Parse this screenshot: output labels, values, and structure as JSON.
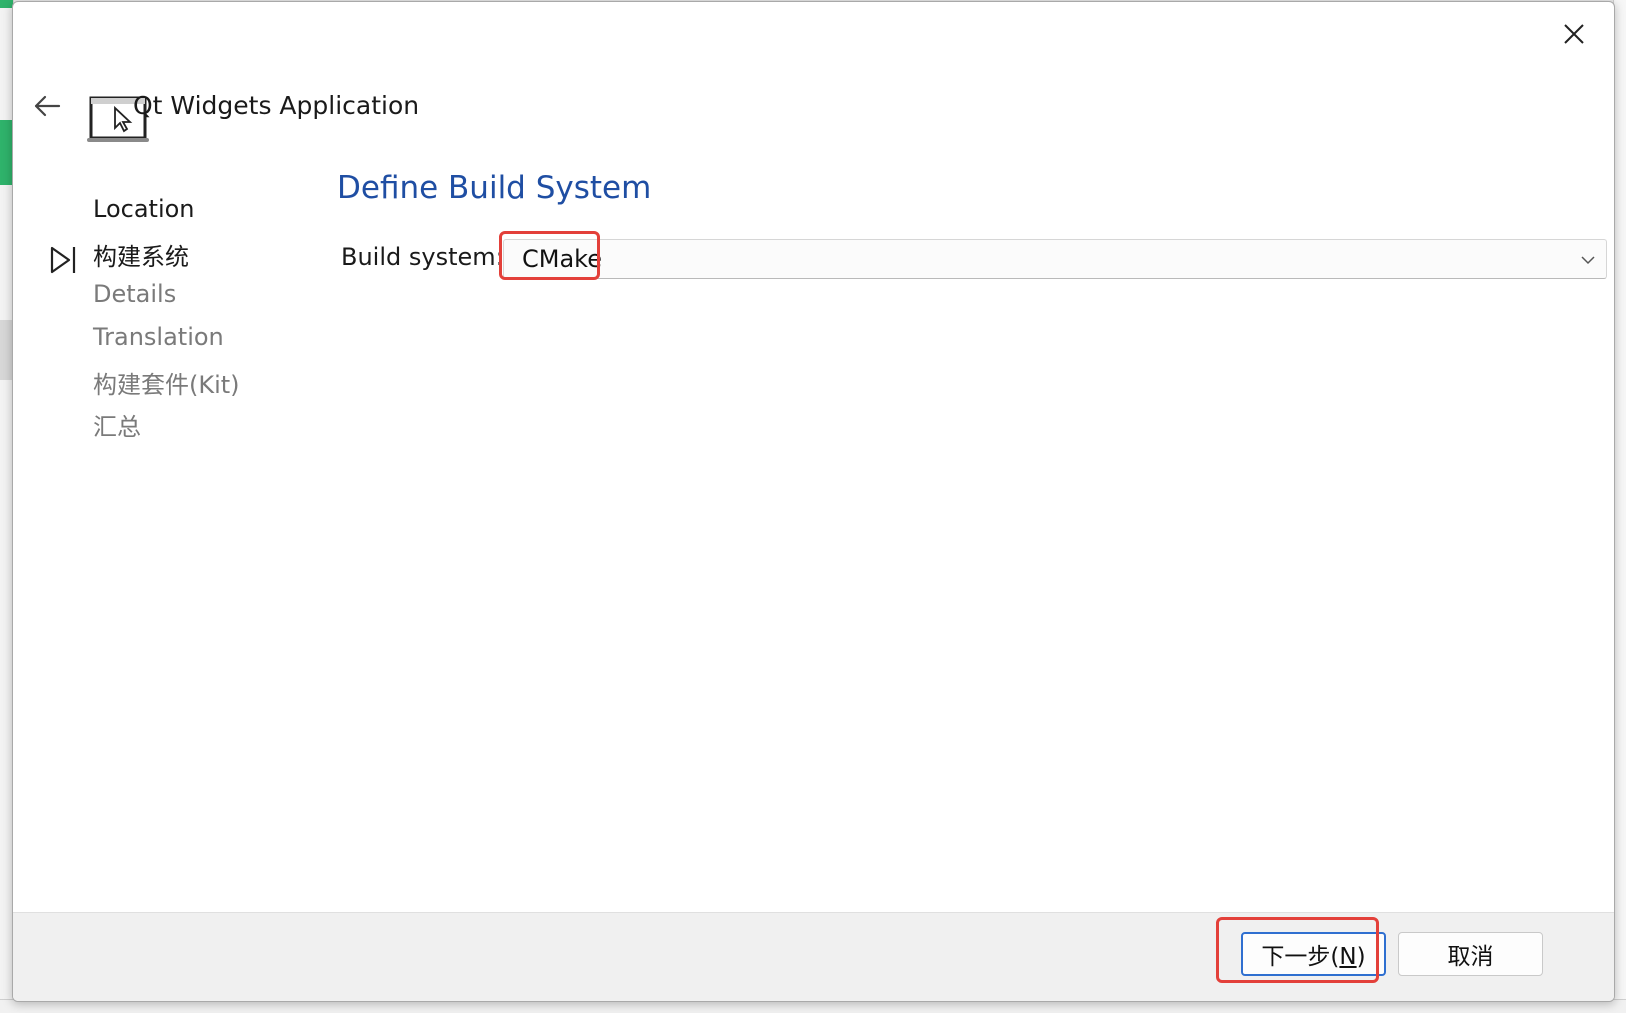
{
  "wizard": {
    "title": "Qt Widgets Application",
    "page_title": "Define Build System"
  },
  "steps": [
    {
      "label": "Location",
      "state": "done"
    },
    {
      "label": "构建系统",
      "state": "current"
    },
    {
      "label": "Details",
      "state": "todo"
    },
    {
      "label": "Translation",
      "state": "todo"
    },
    {
      "label": "构建套件(Kit)",
      "state": "todo"
    },
    {
      "label": "汇总",
      "state": "todo"
    }
  ],
  "form": {
    "build_system_label": "Build system:",
    "build_system_value": "CMake"
  },
  "buttons": {
    "next_prefix": "下一步(",
    "next_mnemonic": "N",
    "next_suffix": ")",
    "cancel": "取消"
  },
  "icons": {
    "back": "arrow-left-icon",
    "close": "close-icon",
    "wizard": "laptop-cursor-icon",
    "step_marker": "play-step-icon",
    "dropdown": "chevron-down-icon"
  },
  "colors": {
    "page_title": "#1f4ea3",
    "highlight": "#e3403a",
    "default_button_border": "#2f6fd0"
  }
}
